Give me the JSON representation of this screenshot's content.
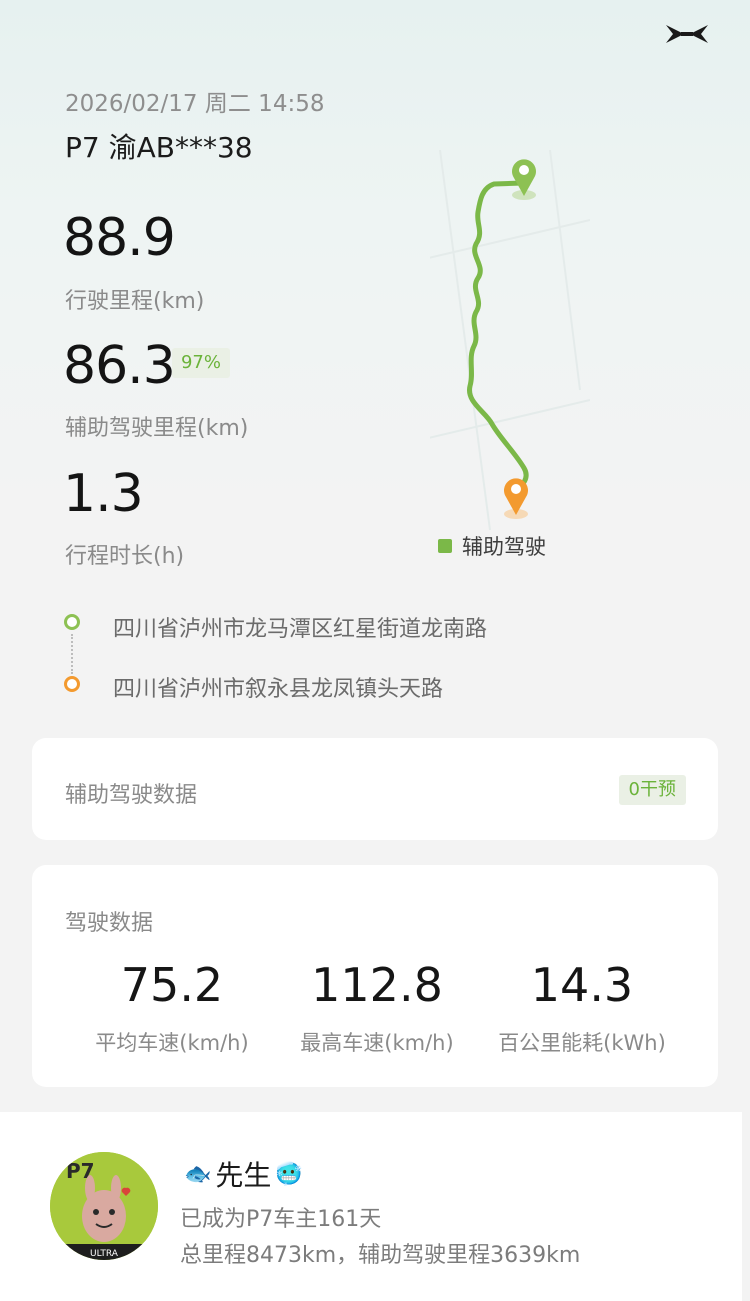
{
  "trip": {
    "datetime": "2026/02/17 周二 14:58",
    "vehicle": "P7 渝AB***38",
    "distance_value": "88.9",
    "distance_label": "行驶里程(km)",
    "assist_value": "86.3",
    "assist_percent": "97%",
    "assist_label": "辅助驾驶里程(km)",
    "duration_value": "1.3",
    "duration_label": "行程时长(h)"
  },
  "map": {
    "legend_label": "辅助驾驶",
    "route_color": "#7bb848",
    "start_color": "#8dc153",
    "end_color": "#f39a2f"
  },
  "addresses": {
    "start": "四川省泸州市龙马潭区红星街道龙南路",
    "end": "四川省泸州市叙永县龙凤镇头天路"
  },
  "assist_card": {
    "title": "辅助驾驶数据",
    "badge": "0干预"
  },
  "drive_card": {
    "title": "驾驶数据",
    "metrics": [
      {
        "value": "75.2",
        "label": "平均车速(km/h)"
      },
      {
        "value": "112.8",
        "label": "最高车速(km/h)"
      },
      {
        "value": "14.3",
        "label": "百公里能耗(kWh)"
      }
    ]
  },
  "user": {
    "name": "先生",
    "name_prefix_icon": "fish-emoji",
    "name_suffix_icon": "cold-face-emoji",
    "owner_text": "已成为P7车主161天",
    "mileage_text": "总里程8473km，辅助驾驶里程3639km",
    "avatar_logo_text": "P7",
    "avatar_band_text": "ULTRA"
  },
  "icons": {
    "brand": "xpeng-logo-icon"
  }
}
